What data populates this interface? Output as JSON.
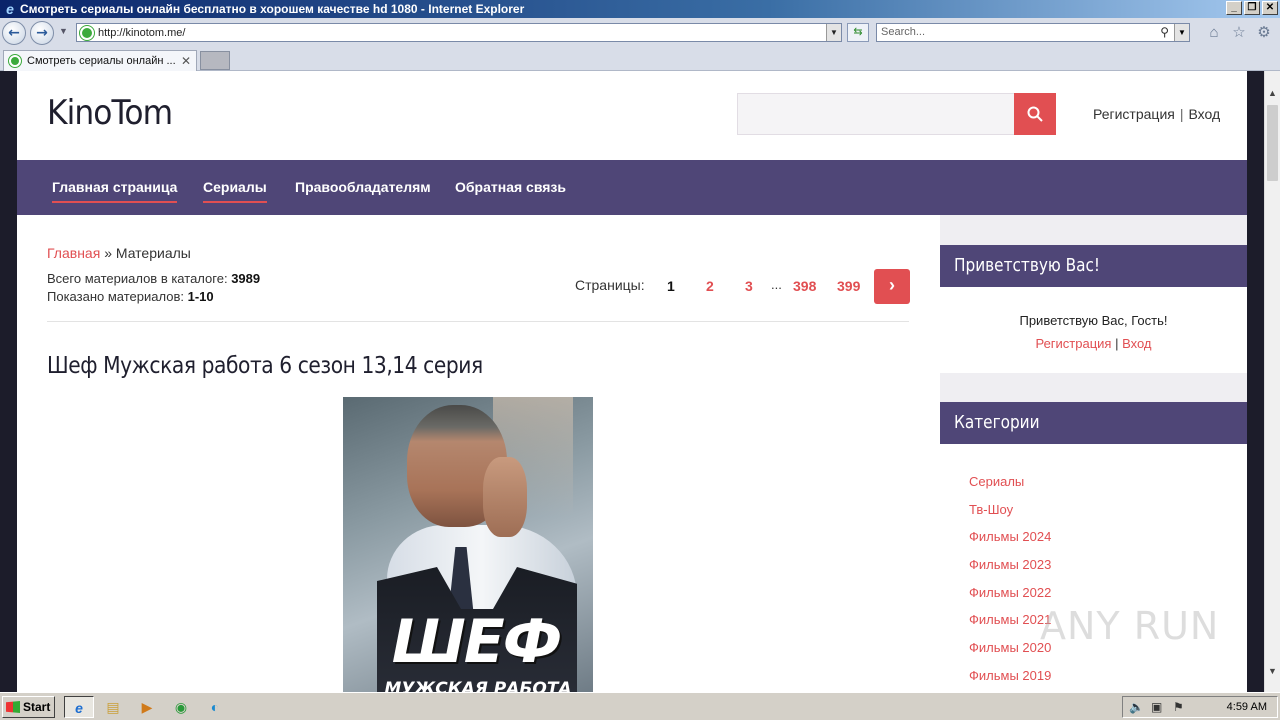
{
  "window": {
    "title": "Смотреть сериалы онлайн бесплатно в хорошем качестве hd 1080 - Internet Explorer",
    "controls": {
      "minimize": "_",
      "maximize": "❐",
      "close": "✕"
    }
  },
  "browser": {
    "url": "http://kinotom.me/",
    "search_placeholder": "Search...",
    "tab_title": "Смотреть сериалы онлайн ...",
    "icons": [
      "back-icon",
      "forward-icon",
      "refresh-icon",
      "home-icon",
      "star-icon",
      "gear-icon"
    ]
  },
  "site": {
    "logo": "KinoTom",
    "auth": {
      "register": "Регистрация",
      "separator": "|",
      "login": "Вход"
    },
    "nav": [
      "Главная страница",
      "Сериалы",
      "Правообладателям",
      "Обратная связь"
    ],
    "breadcrumb": {
      "home": "Главная",
      "sep": "»",
      "current": "Материалы"
    },
    "stats": {
      "total_label": "Всего материалов в каталоге:",
      "total_value": "3989",
      "shown_label": "Показано материалов:",
      "shown_value": "1-10"
    },
    "pager": {
      "label": "Страницы:",
      "pages": [
        "1",
        "2",
        "3",
        "398",
        "399"
      ],
      "current": "1",
      "dots": "...",
      "next_icon": "chevron-right-icon"
    },
    "post": {
      "title": "Шеф Мужская работа 6 сезон 13,14 серия",
      "poster_title": "ШЕФ",
      "poster_subtitle": "МУЖСКАЯ РАБОТА"
    },
    "sidebar": {
      "welcome": {
        "title": "Приветствую Вас!",
        "text": "Приветствую Вас, Гость!",
        "register": "Регистрация",
        "sep": "|",
        "login": "Вход"
      },
      "categories": {
        "title": "Категории",
        "items": [
          "Сериалы",
          "Тв-Шоу",
          "Фильмы 2024",
          "Фильмы 2023",
          "Фильмы 2022",
          "Фильмы 2021",
          "Фильмы 2020",
          "Фильмы 2019"
        ]
      }
    },
    "colors": {
      "accent": "#e14f52",
      "nav_bg": "#4f4677"
    }
  },
  "watermark": "ANY RUN",
  "taskbar": {
    "start": "Start",
    "clock": "4:59 AM"
  }
}
